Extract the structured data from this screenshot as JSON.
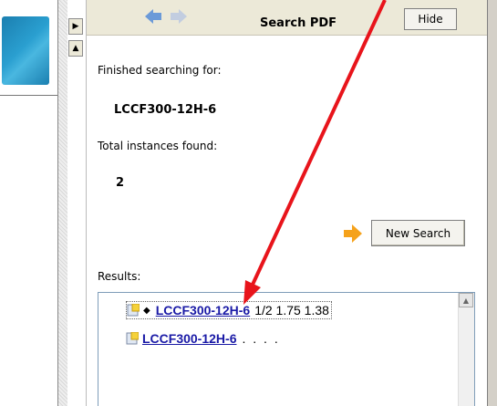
{
  "panel": {
    "title": "Search PDF",
    "hide_label": "Hide",
    "finished_label": "Finished searching for:",
    "search_term": "LCCF300-12H-6",
    "total_label": "Total instances found:",
    "total_count": "2",
    "new_search_label": "New Search",
    "results_label": "Results:"
  },
  "results": [
    {
      "bullet": "◆",
      "link": "LCCF300-12H-6",
      "suffix": "1/2 1.75 1.38"
    },
    {
      "bullet": "",
      "link": "LCCF300-12H-6",
      "suffix": ". . . ."
    }
  ],
  "colors": {
    "annotation_arrow": "#e8141b",
    "link": "#1a1aa6",
    "nav_arrow": "#6b9ad8",
    "new_search_arrow": "#f5a21b"
  }
}
